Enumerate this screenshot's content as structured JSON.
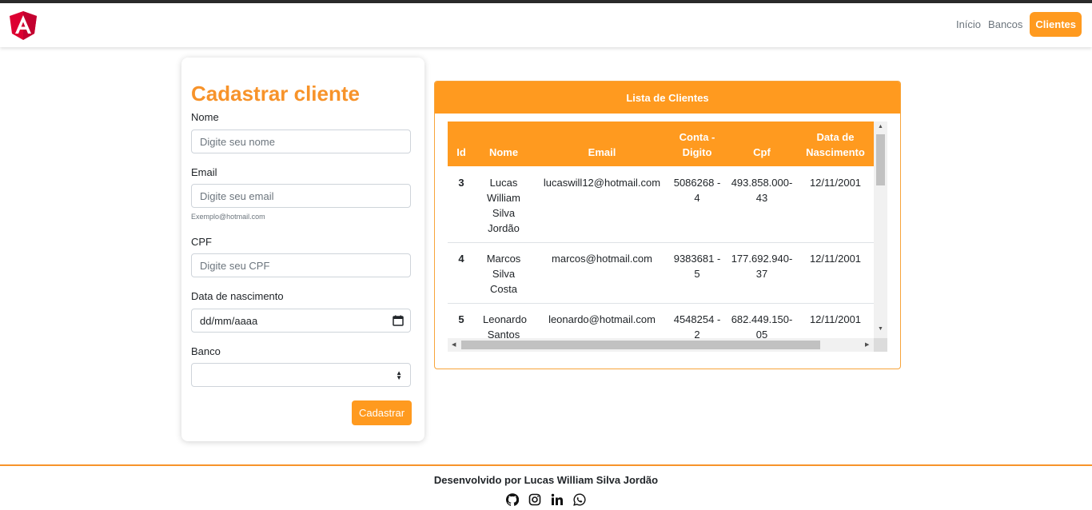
{
  "nav": {
    "links": [
      "Início",
      "Bancos",
      "Clientes"
    ],
    "active": "Clientes"
  },
  "form": {
    "title": "Cadastrar cliente",
    "nome_label": "Nome",
    "nome_placeholder": "Digite seu nome",
    "email_label": "Email",
    "email_placeholder": "Digite seu email",
    "email_hint": "Exemplo@hotmail.com",
    "cpf_label": "CPF",
    "cpf_placeholder": "Digite seu CPF",
    "nascimento_label": "Data de nascimento",
    "nascimento_placeholder": "dd/mm/aaaa",
    "banco_label": "Banco",
    "banco_value": "",
    "submit_label": "Cadastrar"
  },
  "list": {
    "title": "Lista de Clientes",
    "columns": [
      "Id",
      "Nome",
      "Email",
      "Conta - Digito",
      "Cpf",
      "Data de Nascimento"
    ],
    "rows": [
      {
        "id": "3",
        "nome": "Lucas William Silva Jordão",
        "email": "lucaswill12@hotmail.com",
        "conta": "5086268 - 4",
        "cpf": "493.858.000-43",
        "nascimento": "12/11/2001"
      },
      {
        "id": "4",
        "nome": "Marcos Silva Costa",
        "email": "marcos@hotmail.com",
        "conta": "9383681 - 5",
        "cpf": "177.692.940-37",
        "nascimento": "12/11/2001"
      },
      {
        "id": "5",
        "nome": "Leonardo Santos",
        "email": "leonardo@hotmail.com",
        "conta": "4548254 - 2",
        "cpf": "682.449.150-05",
        "nascimento": "12/11/2001"
      }
    ]
  },
  "footer": {
    "text": "Desenvolvido por Lucas William Silva Jordão",
    "icons": [
      "github-icon",
      "instagram-icon",
      "linkedin-icon",
      "whatsapp-icon"
    ]
  },
  "colors": {
    "accent": "#ff9a1f",
    "title": "#f7932a",
    "logo": "#dd0031"
  }
}
